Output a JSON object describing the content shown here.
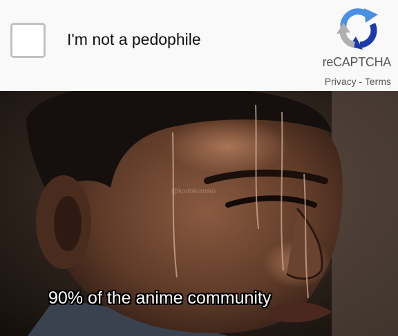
{
  "captcha": {
    "checkbox_label": "I'm not a pedophile",
    "brand": "reCAPTCHA",
    "privacy": "Privacy",
    "separator": " - ",
    "terms": "Terms",
    "checked": false,
    "logo_colors": {
      "blue": "#4a90e2",
      "dark_blue": "#1c3aa9",
      "grey": "#b0b0b0"
    }
  },
  "photo": {
    "watermark": "@kodokuneko",
    "caption": "90% of the anime community",
    "description_icon": "sweating-man-closeup"
  }
}
